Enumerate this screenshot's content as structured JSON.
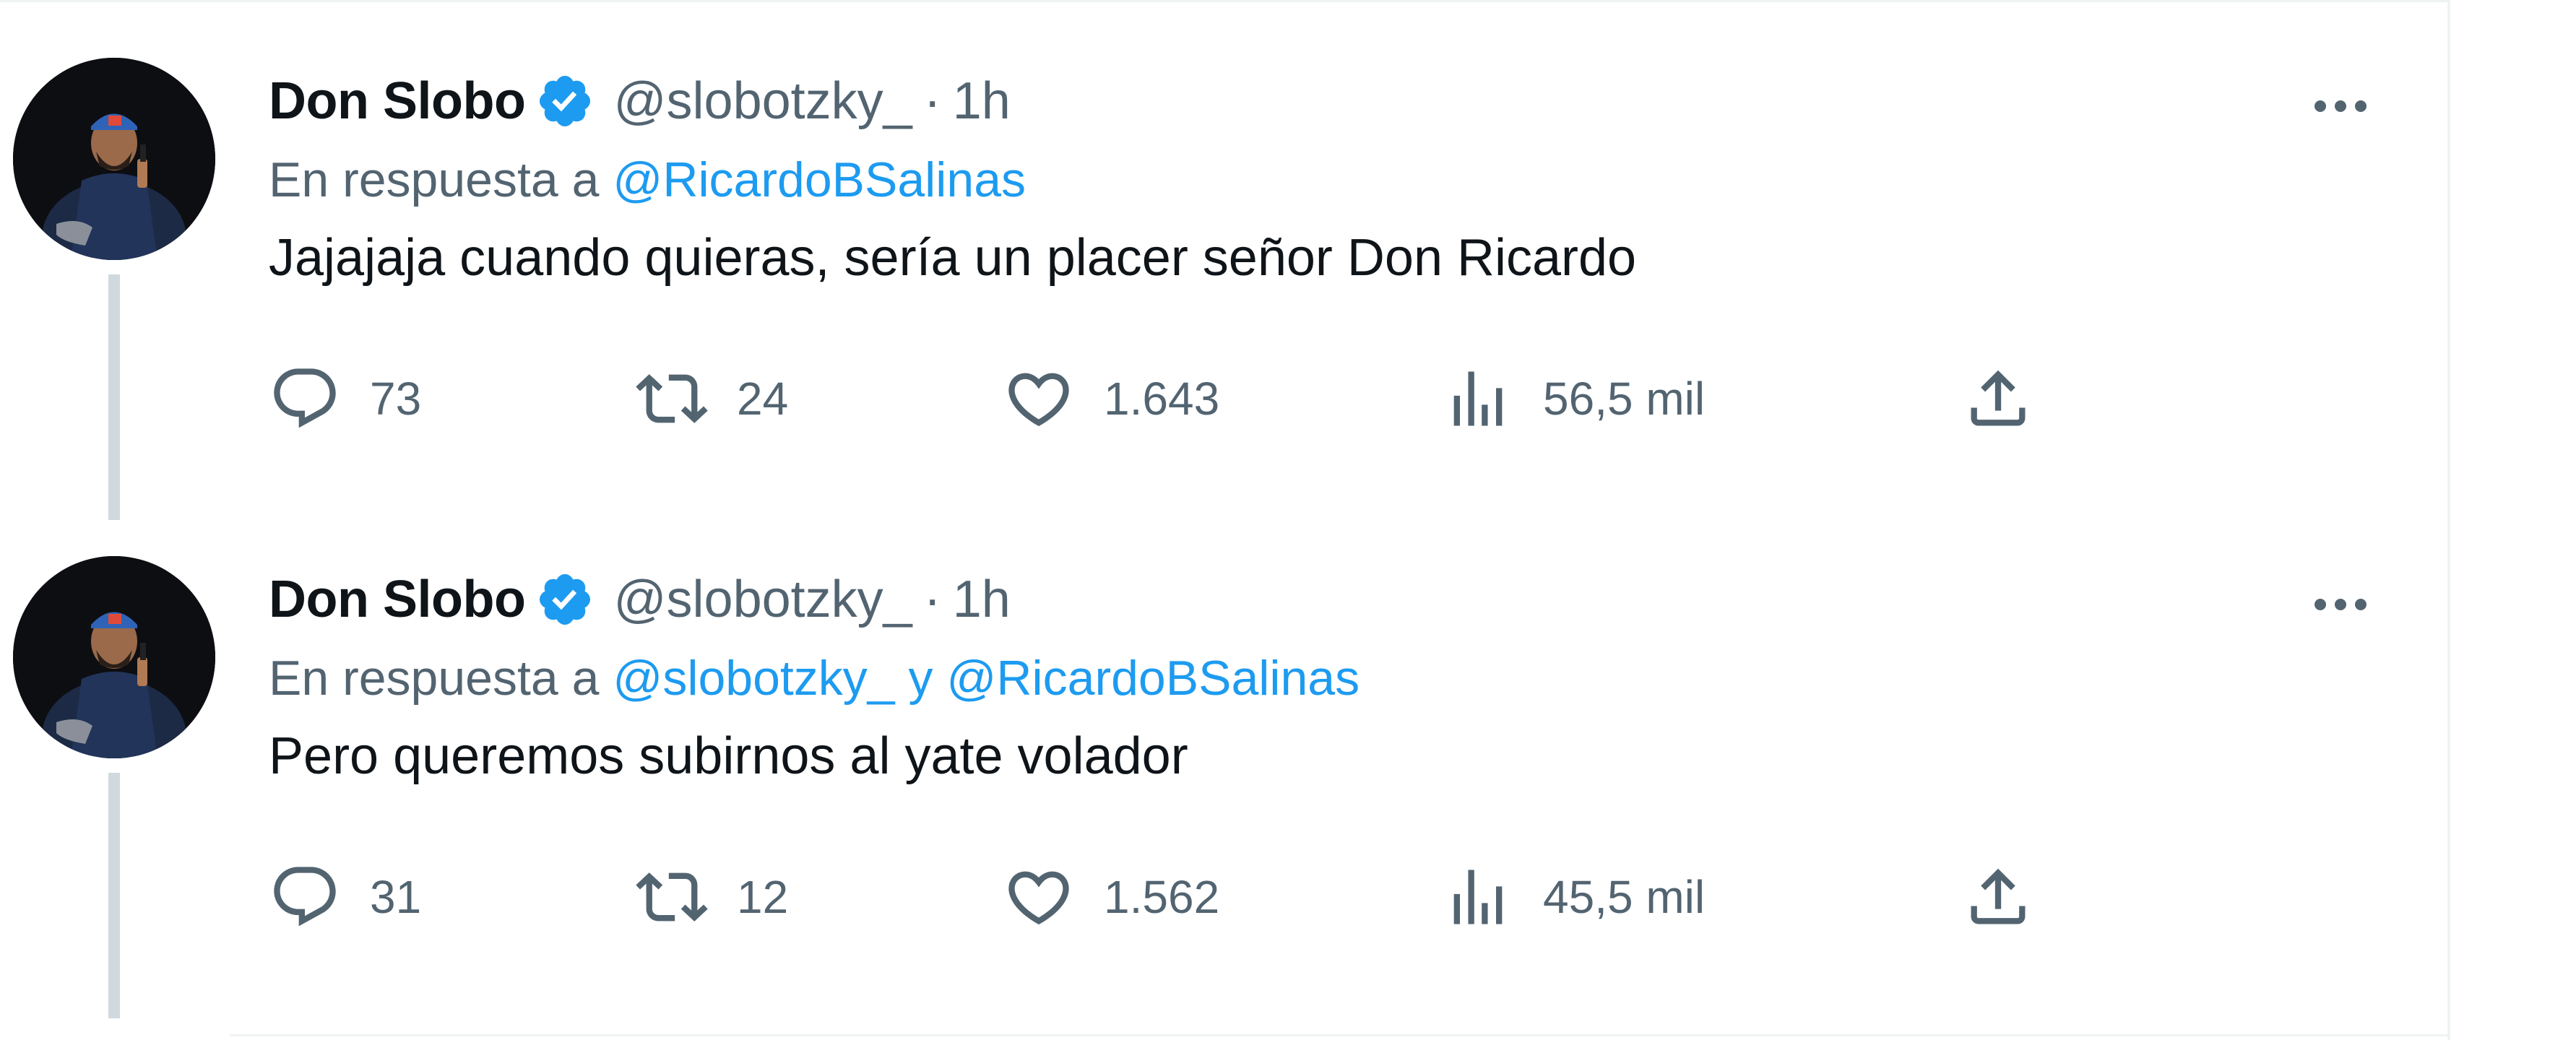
{
  "tweets": [
    {
      "name": "Don Slobo",
      "handle": "@slobotzky_",
      "separator": "·",
      "time": "1h",
      "reply_prefix": "En respuesta a",
      "reply_mentions": "@RicardoBSalinas",
      "text": "Jajajaja cuando quieras, sería un placer señor Don Ricardo",
      "replies": "73",
      "retweets": "24",
      "likes": "1.643",
      "views": "56,5 mil",
      "icons": [
        "verified-badge-icon",
        "more-icon",
        "reply-icon",
        "retweet-icon",
        "like-icon",
        "views-icon",
        "share-icon"
      ]
    },
    {
      "name": "Don Slobo",
      "handle": "@slobotzky_",
      "separator": "·",
      "time": "1h",
      "reply_prefix": "En respuesta a",
      "reply_mentions": "@slobotzky_ y @RicardoBSalinas",
      "text": "Pero queremos subirnos al yate volador",
      "replies": "31",
      "retweets": "12",
      "likes": "1.562",
      "views": "45,5 mil",
      "icons": [
        "verified-badge-icon",
        "more-icon",
        "reply-icon",
        "retweet-icon",
        "like-icon",
        "views-icon",
        "share-icon"
      ]
    }
  ],
  "colors": {
    "text": "#0f1419",
    "secondary": "#536471",
    "accent": "#1d9bf0",
    "thread_line": "#cfd9de",
    "border": "#eff3f4"
  }
}
